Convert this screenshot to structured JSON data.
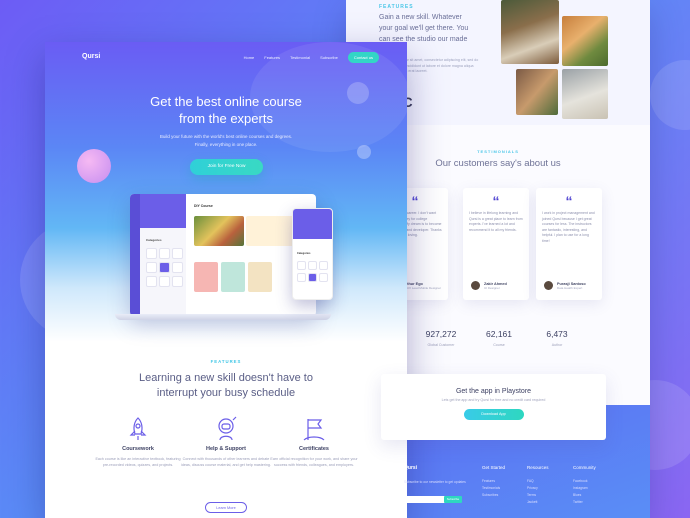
{
  "back": {
    "features_label": "FEATURES",
    "features_heading": "Gain a new skill. Whatever your goal we'll get there. You can see the studio our made",
    "features_body": "Lorem ipsum dolor sit amet, consectetur adipiscing elit, sed do eiusmod tempor incididunt ut labore et dolore magna aliqua placerat et aliquet erat laoreet.",
    "logos_text": "O)C",
    "testimonials_label": "TESTIMONIALS",
    "testimonials_title": "Our customers say's about us",
    "testimonials": [
      {
        "quote": "Qursi is the career. I don't want time or money for college education. My dream is to become a specialist and developer. Thanks to Qursi, I'm loving.",
        "name": "Arthur Ego",
        "role": "UI/UX Lead Mobile Designer"
      },
      {
        "quote": "I believe in lifelong learning and Qursi is a great place to learn from experts. I've learned a lot and recommend it to all my friends.",
        "name": "Zakir Ahmed",
        "role": "UI Designer"
      },
      {
        "quote": "I work in project management and joined Qursi because I get great courses for less. The instructors are fantastic, interesting, and helpful. I plan to use for a long time!",
        "name": "Purasji Santoso",
        "role": "Data Health Expert"
      }
    ],
    "stats": [
      {
        "value": "927,272",
        "label": "Global Customer"
      },
      {
        "value": "62,161",
        "label": "Course"
      },
      {
        "value": "6,473",
        "label": "Author"
      }
    ],
    "app": {
      "title": "Get the app in Playstore",
      "subtitle": "Lets get the app and try Qursi for free and no credit card required",
      "button": "Download App"
    },
    "footer": {
      "brand": "Qursi",
      "copy": "Subscribe to our newsletter to get updates",
      "subscribe": "Subscribe",
      "columns": [
        {
          "title": "Get Started",
          "items": [
            "Features",
            "Testimonials",
            "Subscribes"
          ]
        },
        {
          "title": "Resources",
          "items": [
            "FAQ",
            "Privacy",
            "Terms",
            "Jackett"
          ]
        },
        {
          "title": "Community",
          "items": [
            "Facebook",
            "Instagram",
            "Blues",
            "Twitter"
          ]
        }
      ]
    }
  },
  "front": {
    "brand": "Qursi",
    "nav": [
      "Home",
      "Features",
      "Testimonial",
      "Subscribe"
    ],
    "nav_cta": "Contact us",
    "hero_title_1": "Get the best online course",
    "hero_title_2": "from the experts",
    "hero_sub_1": "Build your future with the world's best online courses and degrees.",
    "hero_sub_2": "Finally, everything in one place.",
    "hero_button": "Join for Free Now",
    "laptop": {
      "course_title": "DIY Course",
      "categories": "Categories",
      "side_title": "Web Developer"
    },
    "phone": {
      "categories": "Categories"
    },
    "features_label": "FEATURES",
    "features_title_1": "Learning a new skill doesn't have to",
    "features_title_2": "interrupt your busy schedule",
    "features": [
      {
        "title": "Coursework",
        "desc": "Each course is like an interactive textbook, featuring pre-recorded videos, quizzes, and projects.",
        "icon": "rocket-icon"
      },
      {
        "title": "Help & Support",
        "desc": "Connect with thousands of other learners and debate ideas, discuss course material, and get help mastering.",
        "icon": "astronaut-icon"
      },
      {
        "title": "Certificates",
        "desc": "Earn official recognition for your work, and share your success with friends, colleagues, and employers.",
        "icon": "flag-icon"
      }
    ],
    "learn_more": "Learn More"
  },
  "colors": {
    "primary": "#6b5ee8",
    "accent": "#33d6c6",
    "heading": "#3d4163"
  }
}
